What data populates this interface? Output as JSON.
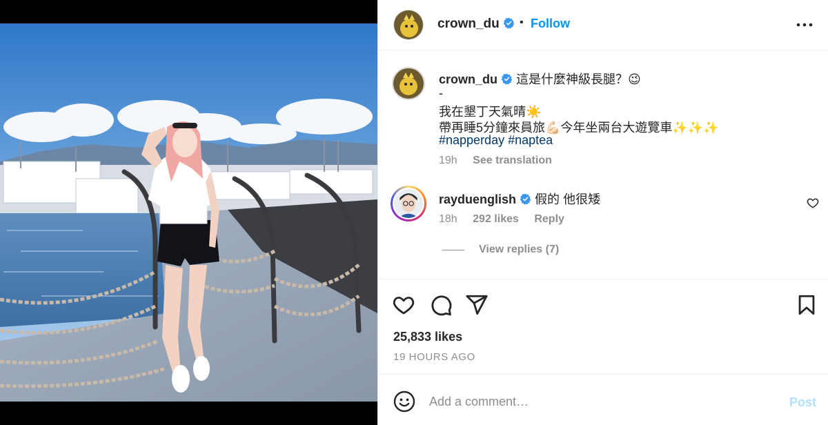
{
  "post": {
    "author": "crown_du",
    "follow_label": "Follow",
    "dot": "•",
    "more_icon": "more-horizontal-icon"
  },
  "caption": {
    "username": "crown_du",
    "line1": "這是什麼神級長腿？😉",
    "line2": "-",
    "line3": "我在墾丁天氣晴☀️",
    "line4": "帶再睡5分鐘來員旅💪🏻今年坐兩台大遊覽車✨✨✨",
    "hashtag1": "#napperday",
    "hashtag2": "#naptea",
    "time": "19h",
    "translate_label": "See translation"
  },
  "comments": [
    {
      "username": "rayduenglish",
      "text": "假的 他很矮",
      "time": "18h",
      "likes": "292 likes",
      "reply_label": "Reply",
      "view_replies": "View replies (7)"
    }
  ],
  "stats": {
    "likes": "25,833 likes",
    "time_ago": "19 HOURS AGO"
  },
  "composer": {
    "placeholder": "Add a comment…",
    "post_label": "Post"
  },
  "colors": {
    "link": "#0095f6",
    "hashtag": "#00376b",
    "muted": "#8e8e8e",
    "post_disabled": "#b2dffc"
  }
}
